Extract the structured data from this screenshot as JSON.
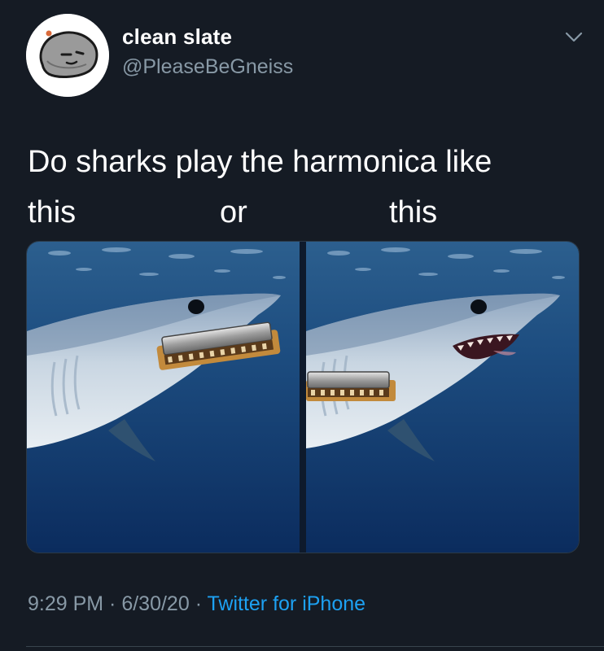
{
  "author": {
    "display_name": "clean slate",
    "handle": "@PleaseBeGneiss",
    "avatar_icon": "rock-face-avatar"
  },
  "menu": {
    "icon": "chevron-down-icon"
  },
  "tweet": {
    "text_line1": "Do sharks play the harmonica like",
    "text_word1": "this",
    "text_word2": "or",
    "text_word3": "this"
  },
  "media": {
    "left_image": "shark-holding-harmonica-in-closed-mouth",
    "right_image": "shark-with-harmonica-through-gills"
  },
  "footer": {
    "time": "9:29 PM",
    "sep1": " · ",
    "date": "6/30/20",
    "sep2": " · ",
    "source": "Twitter for iPhone"
  },
  "colors": {
    "background": "#151b24",
    "secondary_text": "#8899a6",
    "link": "#1da1f2"
  }
}
